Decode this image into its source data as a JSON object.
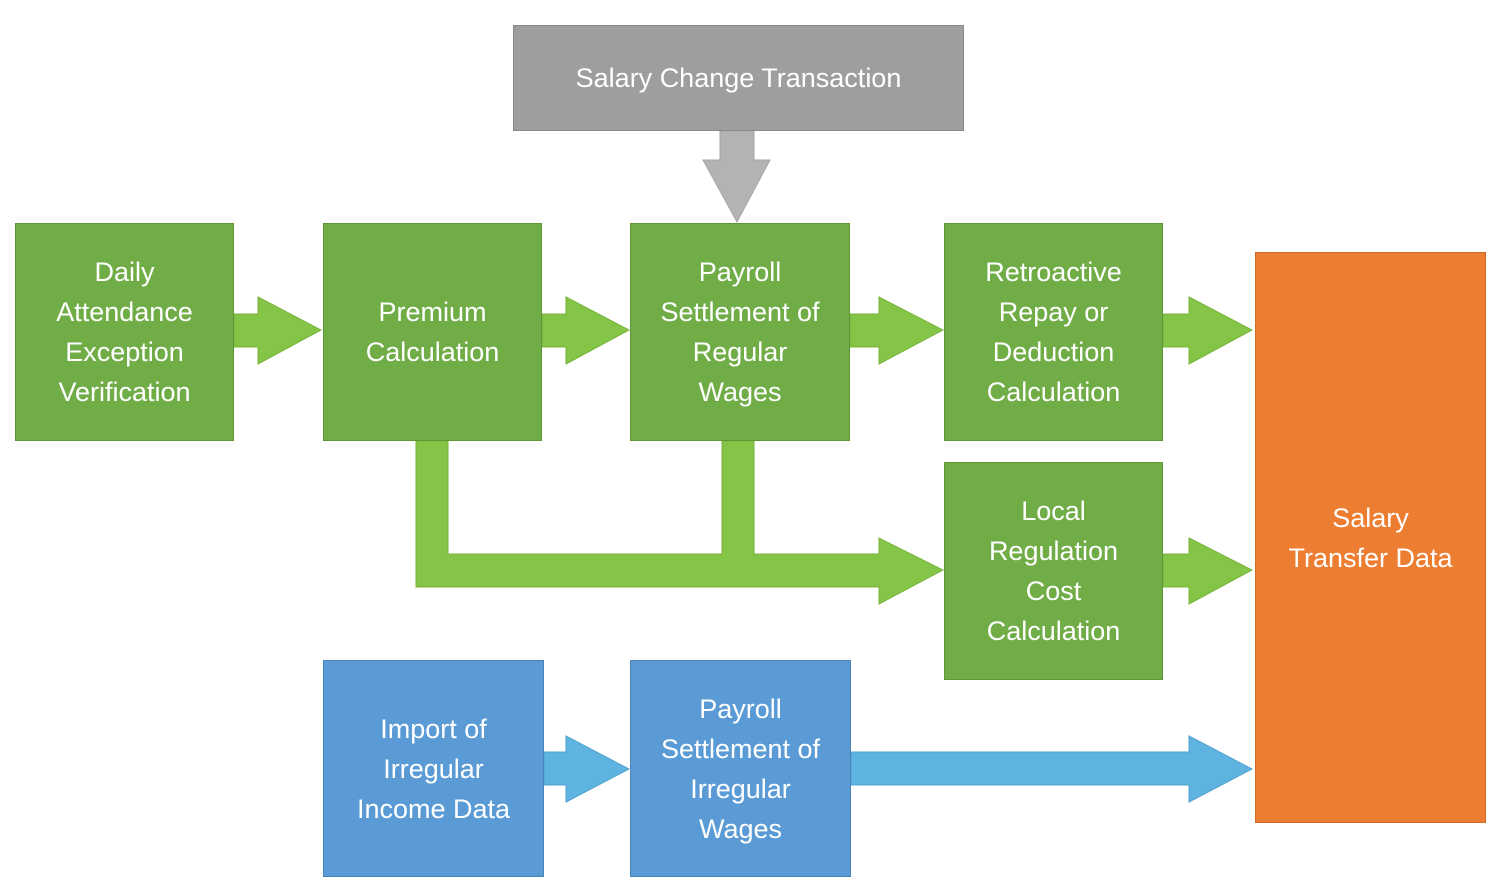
{
  "colors": {
    "process_green": "#70ad47",
    "arrow_green": "#84c446",
    "source_gray": "#9e9e9e",
    "arrow_gray": "#b3b3b3",
    "irregular_blue": "#5b9bd5",
    "arrow_blue": "#5eb3e0",
    "output_orange": "#ed7d31"
  },
  "nodes": {
    "salary_change": "Salary Change Transaction",
    "daily_attendance": "Daily\nAttendance\nException\nVerification",
    "premium": "Premium\nCalculation",
    "payroll_regular": "Payroll\nSettlement of\nRegular\nWages",
    "retroactive": "Retroactive\nRepay or\nDeduction\nCalculation",
    "local_regulation": "Local\nRegulation\nCost\nCalculation",
    "salary_transfer": "Salary\nTransfer Data",
    "import_irregular": "Import of\nIrregular\nIncome Data",
    "payroll_irregular": "Payroll\nSettlement of\nIrregular\nWages"
  },
  "edges": [
    [
      "salary_change",
      "payroll_regular"
    ],
    [
      "daily_attendance",
      "premium"
    ],
    [
      "premium",
      "payroll_regular"
    ],
    [
      "payroll_regular",
      "retroactive"
    ],
    [
      "retroactive",
      "salary_transfer"
    ],
    [
      "premium",
      "local_regulation"
    ],
    [
      "payroll_regular",
      "local_regulation"
    ],
    [
      "local_regulation",
      "salary_transfer"
    ],
    [
      "import_irregular",
      "payroll_irregular"
    ],
    [
      "payroll_irregular",
      "salary_transfer"
    ]
  ]
}
